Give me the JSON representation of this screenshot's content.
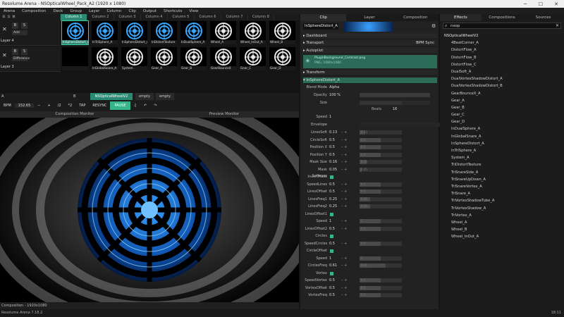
{
  "window": {
    "title": "Resolume Arena - NSOpticalWheel_Pack_A2 (1920 x 1080)",
    "minimize": "─",
    "maximize": "☐",
    "close": "✕"
  },
  "menu": [
    "Arena",
    "Composition",
    "Deck",
    "Group",
    "Layer",
    "Column",
    "Clip",
    "Output",
    "Shortcuts",
    "View"
  ],
  "deck": {
    "b_label": "B",
    "s_label": "S",
    "m_label": "M",
    "columns": [
      "Column 1",
      "Column 2",
      "Column 3",
      "Column 4",
      "Column 5",
      "Column 6",
      "Column 7",
      "Column 8"
    ]
  },
  "layers": [
    {
      "name": "Layer 4",
      "dropdown": "Add",
      "clips": [
        {
          "name": "InSphereDistort_A",
          "on": true
        },
        {
          "name": "InTriSphere_A",
          "on": false
        },
        {
          "name": "InSphereDistort_A",
          "on": false
        },
        {
          "name": "InDistortTexture",
          "on": false
        },
        {
          "name": "InDualSphere_A",
          "on": false
        },
        {
          "name": "Wheel_A",
          "on": false
        },
        {
          "name": "Wheel_InOut_A",
          "on": false
        },
        {
          "name": "Wheel_B",
          "on": false
        }
      ]
    },
    {
      "name": "Layer 3",
      "dropdown": "Difference",
      "clips": [
        {
          "name": "",
          "on": false
        },
        {
          "name": "InGlobalSnare_A",
          "on": false
        },
        {
          "name": "System",
          "on": false
        },
        {
          "name": "Gear_A",
          "on": false
        },
        {
          "name": "Gear_B",
          "on": false
        },
        {
          "name": "GearBounceX",
          "on": false
        },
        {
          "name": "Gear_C",
          "on": false
        },
        {
          "name": "Gear_D",
          "on": false
        }
      ]
    }
  ],
  "deckbar": {
    "a": "A",
    "b": "B",
    "deck_name": "NSOpticalWheelV2",
    "empty1": "empty",
    "empty2": "empty"
  },
  "transport": {
    "bpm_label": "BPM",
    "bpm": "152.65",
    "minus": "−",
    "plus": "+",
    "half": "/2",
    "double": "*2",
    "tap": "TAP",
    "resync": "RESYNC",
    "pause": "PAUSE"
  },
  "monitors": {
    "composition": "Composition Monitor",
    "preview": "Preview Monitor"
  },
  "footer": {
    "composition": "Composition - 1920x1080"
  },
  "status": {
    "app": "Resolume Arena 7.18.2",
    "time": "18:11"
  },
  "mid": {
    "tabs": [
      "Clip",
      "Layer",
      "Composition"
    ],
    "clip_name": "InSphereDistort_A",
    "sections": {
      "dashboard": "Dashboard",
      "transport": "Transport",
      "bpm_sync": "BPM Sync",
      "autopilot": "Autopilot",
      "transform": "Transform",
      "effect": "InSphereDistort_A"
    },
    "file": {
      "name": "PluginBackground_Contrast.png",
      "info": "PNG, 1080x1080"
    },
    "blend_label": "Blend Mode",
    "blend": "Alpha",
    "opacity_label": "Opacity",
    "opacity": "100 %",
    "size_label": "Size",
    "beats_label": "Beats",
    "beats": "16",
    "speed_label": "Speed",
    "speed": "1",
    "envelope_label": "Envelope",
    "params": [
      {
        "label": "LinesSoft",
        "value": "0.13",
        "fill": 0.13
      },
      {
        "label": "CircleSoft",
        "value": "0.5",
        "fill": 0.5
      },
      {
        "label": "Position X",
        "value": "0.5",
        "fill": 0.5
      },
      {
        "label": "Position Y",
        "value": "0.5",
        "fill": 0.5
      },
      {
        "label": "Mask Size",
        "value": "0.16",
        "fill": 0.16
      },
      {
        "label": "Mask Softness",
        "value": "0.05",
        "fill": 0.05
      },
      {
        "label": "InvertMask",
        "value": "",
        "fill": 0
      },
      {
        "label": "SpeedLines",
        "value": "0.5",
        "fill": 0.5
      },
      {
        "label": "LinesOffset",
        "value": "0.5",
        "fill": 0.5
      },
      {
        "label": "LinesFreq1",
        "value": "0.25",
        "fill": 0.25
      },
      {
        "label": "LinesFreq2",
        "value": "0.25",
        "fill": 0.25
      },
      {
        "label": "LinesOffset1",
        "value": "",
        "fill": 0
      },
      {
        "label": "Speed",
        "value": "1",
        "fill": 0.5
      },
      {
        "label": "LinesOffset2",
        "value": "0.5",
        "fill": 0.5
      },
      {
        "label": "Circles",
        "value": "",
        "fill": 0
      },
      {
        "label": "SpeedCircles",
        "value": "0.5",
        "fill": 0.5
      },
      {
        "label": "CircleOffset",
        "value": "",
        "fill": 0
      },
      {
        "label": "Speed",
        "value": "1",
        "fill": 0.5
      },
      {
        "label": "CirclesFreq",
        "value": "0.61",
        "fill": 0.61
      },
      {
        "label": "Vortex",
        "value": "",
        "fill": 0
      },
      {
        "label": "SpeedVortex",
        "value": "0.5",
        "fill": 0.5
      },
      {
        "label": "VortexOffset",
        "value": "0.5",
        "fill": 0.5
      },
      {
        "label": "VortexFreq",
        "value": "0.5",
        "fill": 0.5
      }
    ]
  },
  "right": {
    "tabs": [
      "Effects",
      "Compositions",
      "Sources"
    ],
    "search": "nsop",
    "root": "NSOpticalWheelV2",
    "items": [
      "4BeatCorner_A",
      "DistortFlow_A",
      "DistortFlow_B",
      "DistortFlow_C",
      "DualSoft_A",
      "DualVortexShadowDistort_A",
      "DualVortexShadowDistort_B",
      "GearBounceX_A",
      "Gear_A",
      "Gear_B",
      "Gear_C",
      "Gear_D",
      "InDualSphere_A",
      "InGlobalSnare_A",
      "InSphereDistort_A",
      "InTriSphere_A",
      "System_A",
      "TriDistortTexture",
      "TriSnareSide_A",
      "TriSnareUpDown_A",
      "TriSnareVortex_A",
      "TriSnare_A",
      "TriVortexShadowTube_A",
      "TriVortexShadow_A",
      "TriVortex_A",
      "Wheel_A",
      "Wheel_B",
      "Wheel_InOut_A"
    ]
  }
}
